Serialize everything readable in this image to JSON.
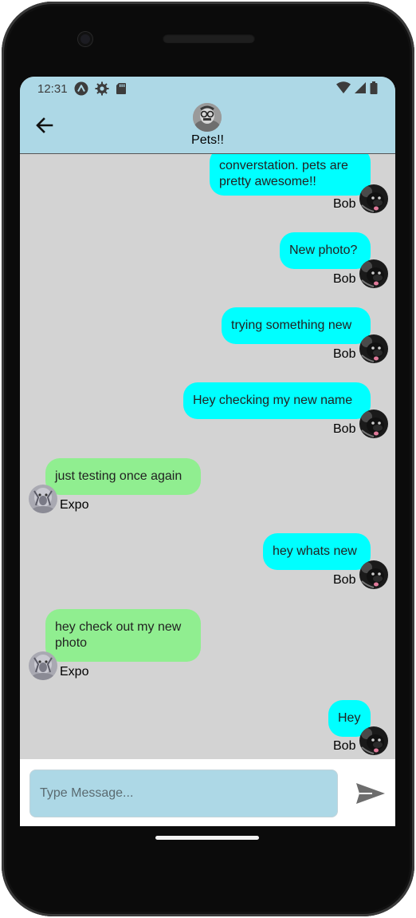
{
  "status_bar": {
    "time": "12:31",
    "left_icons": [
      "expo-icon",
      "settings-gear-icon",
      "sd-card-icon"
    ],
    "right_icons": [
      "wifi-icon",
      "signal-icon",
      "battery-icon"
    ]
  },
  "header": {
    "title": "Pets!!",
    "back_icon": "arrow-left-icon",
    "avatar_icon": "group-avatar"
  },
  "colors": {
    "header_bg": "#add8e6",
    "chat_bg": "#d3d3d3",
    "outgoing_bubble": "#00ffff",
    "incoming_bubble": "#90ee90"
  },
  "messages": [
    {
      "direction": "out",
      "lines": [
        "converstation. pets are",
        "pretty awesome!!"
      ],
      "sender": "Bob"
    },
    {
      "direction": "out",
      "lines": [
        "New photo?"
      ],
      "sender": "Bob"
    },
    {
      "direction": "out",
      "lines": [
        "trying something new"
      ],
      "sender": "Bob"
    },
    {
      "direction": "out",
      "lines": [
        "Hey checking my new name"
      ],
      "sender": "Bob"
    },
    {
      "direction": "in",
      "lines": [
        "just testing once again"
      ],
      "sender": "Expo"
    },
    {
      "direction": "out",
      "lines": [
        "hey whats new"
      ],
      "sender": "Bob"
    },
    {
      "direction": "in",
      "lines": [
        "hey check out my new",
        "photo"
      ],
      "sender": "Expo"
    },
    {
      "direction": "out",
      "lines": [
        "Hey"
      ],
      "sender": "Bob"
    }
  ],
  "composer": {
    "placeholder": "Type Message...",
    "value": "",
    "send_icon": "send-icon"
  }
}
